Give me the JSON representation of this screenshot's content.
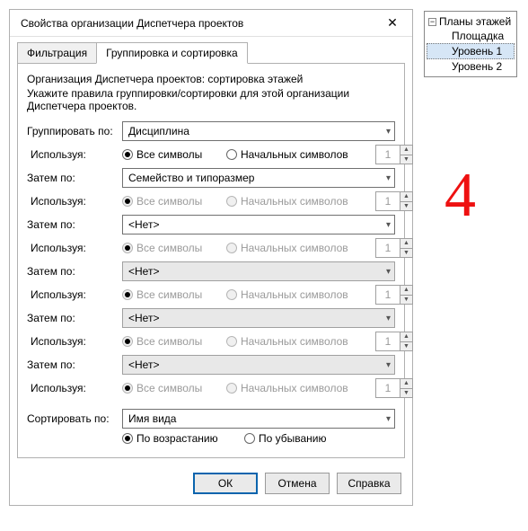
{
  "dialog": {
    "title": "Свойства организации Диспетчера проектов",
    "tabs": {
      "filter": "Фильтрация",
      "group": "Группировка и сортировка"
    },
    "intro1": "Организация Диспетчера проектов: сортировка этажей",
    "intro2": "Укажите правила группировки/сортировки для этой организации Диспетчера проектов.",
    "labels": {
      "group_by": "Группировать по:",
      "using": "Используя:",
      "then_by": "Затем по:",
      "sort_by": "Сортировать по:"
    },
    "radios": {
      "all": "Все символы",
      "leading": "Начальных символов",
      "asc": "По возрастанию",
      "desc": "По убыванию"
    },
    "combo": {
      "discipline": "Дисциплина",
      "family_type": "Семейство и типоразмер",
      "none": "<Нет>",
      "view_name": "Имя вида"
    },
    "spin_value": "1",
    "buttons": {
      "ok": "ОК",
      "cancel": "Отмена",
      "help": "Справка"
    }
  },
  "tree": {
    "root": "Планы этажей",
    "items": [
      "Площадка",
      "Уровень 1",
      "Уровень 2"
    ],
    "selected_index": 1
  },
  "annotation": "4"
}
